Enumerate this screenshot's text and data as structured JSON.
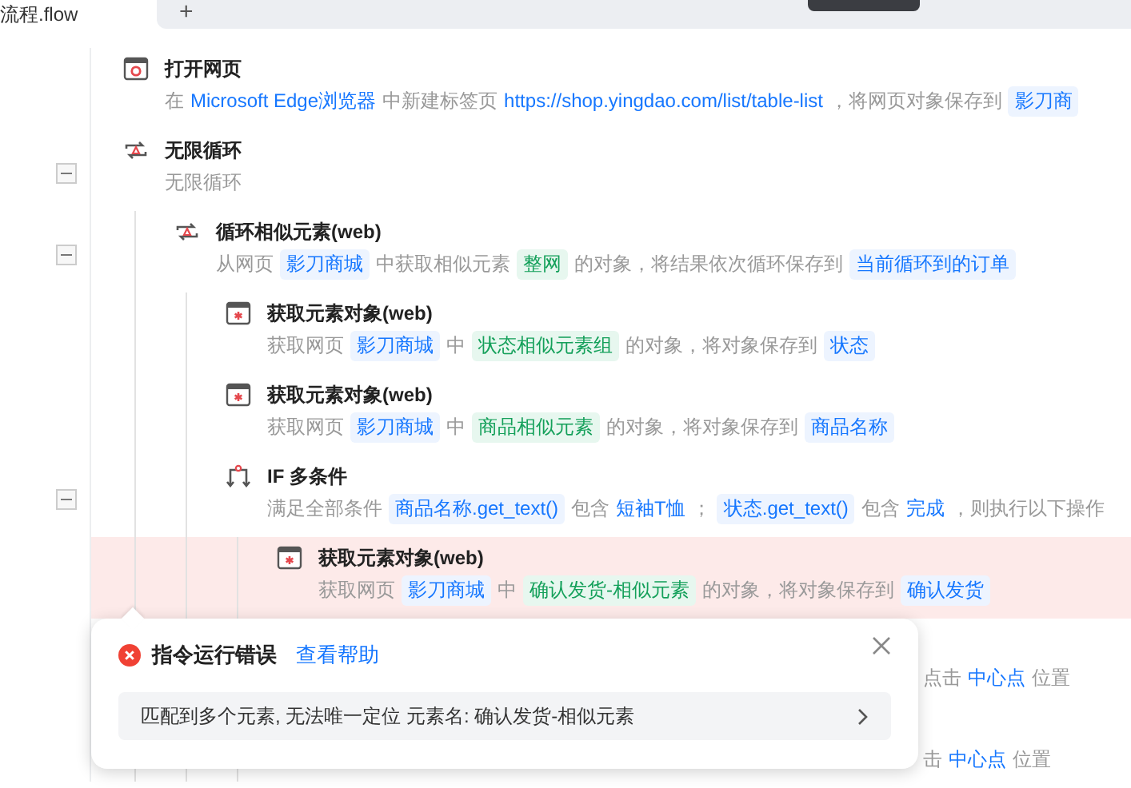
{
  "tab_bar": {
    "tab_label": "流程.flow",
    "add_button": "+"
  },
  "steps": [
    {
      "title": "打开网页",
      "kind": "browser",
      "desc": [
        {
          "t": "在",
          "kind": "text"
        },
        {
          "t": "Microsoft Edge浏览器",
          "kind": "link"
        },
        {
          "t": "中新建标签页",
          "kind": "text"
        },
        {
          "t": "https://shop.yingdao.com/list/table-list",
          "kind": "link"
        },
        {
          "t": "，将网页对象保存到",
          "kind": "text"
        },
        {
          "t": "影刀商",
          "kind": "var"
        }
      ]
    },
    {
      "title": "无限循环",
      "kind": "loop",
      "expanded": true,
      "desc": [
        {
          "t": "无限循环",
          "kind": "text"
        }
      ],
      "children": [
        {
          "title": "循环相似元素(web)",
          "kind": "loop",
          "expanded": true,
          "desc": [
            {
              "t": "从网页",
              "kind": "text"
            },
            {
              "t": "影刀商城",
              "kind": "var"
            },
            {
              "t": "中获取相似元素",
              "kind": "text"
            },
            {
              "t": "整网",
              "kind": "elem"
            },
            {
              "t": "的对象，将结果依次循环保存到",
              "kind": "text"
            },
            {
              "t": "当前循环到的订单",
              "kind": "var"
            }
          ],
          "children": [
            {
              "title": "获取元素对象(web)",
              "kind": "element",
              "desc": [
                {
                  "t": "获取网页",
                  "kind": "text"
                },
                {
                  "t": "影刀商城",
                  "kind": "var"
                },
                {
                  "t": "中",
                  "kind": "text"
                },
                {
                  "t": "状态相似元素组",
                  "kind": "elem"
                },
                {
                  "t": "的对象，将对象保存到",
                  "kind": "text"
                },
                {
                  "t": "状态",
                  "kind": "var"
                }
              ]
            },
            {
              "title": "获取元素对象(web)",
              "kind": "element",
              "desc": [
                {
                  "t": "获取网页",
                  "kind": "text"
                },
                {
                  "t": "影刀商城",
                  "kind": "var"
                },
                {
                  "t": "中",
                  "kind": "text"
                },
                {
                  "t": "商品相似元素",
                  "kind": "elem"
                },
                {
                  "t": "的对象，将对象保存到",
                  "kind": "text"
                },
                {
                  "t": "商品名称",
                  "kind": "var"
                }
              ]
            },
            {
              "title": "IF 多条件",
              "kind": "if",
              "expanded": true,
              "desc": [
                {
                  "t": "满足全部条件",
                  "kind": "text"
                },
                {
                  "t": "商品名称.get_text()",
                  "kind": "var"
                },
                {
                  "t": "包含",
                  "kind": "text"
                },
                {
                  "t": "短袖T恤",
                  "kind": "link"
                },
                {
                  "t": "；",
                  "kind": "text"
                },
                {
                  "t": "状态.get_text()",
                  "kind": "var"
                },
                {
                  "t": "包含",
                  "kind": "text"
                },
                {
                  "t": "完成",
                  "kind": "link"
                },
                {
                  "t": "，则执行以下操作",
                  "kind": "text"
                }
              ],
              "children": [
                {
                  "title": "获取元素对象(web)",
                  "kind": "element",
                  "error": true,
                  "desc": [
                    {
                      "t": "获取网页",
                      "kind": "text"
                    },
                    {
                      "t": "影刀商城",
                      "kind": "var"
                    },
                    {
                      "t": "中",
                      "kind": "text"
                    },
                    {
                      "t": "确认发货-相似元素",
                      "kind": "elem"
                    },
                    {
                      "t": "的对象，将对象保存到",
                      "kind": "text"
                    },
                    {
                      "t": "确认发货",
                      "kind": "var"
                    }
                  ]
                },
                {
                  "kind": "hidden",
                  "desc": [
                    {
                      "t": "点击",
                      "kind": "text"
                    },
                    {
                      "t": "中心点",
                      "kind": "link"
                    },
                    {
                      "t": "位置",
                      "kind": "text"
                    }
                  ]
                },
                {
                  "kind": "hidden",
                  "desc": [
                    {
                      "t": "击",
                      "kind": "text"
                    },
                    {
                      "t": "中心点",
                      "kind": "link"
                    },
                    {
                      "t": "位置",
                      "kind": "text"
                    }
                  ]
                }
              ]
            }
          ]
        }
      ]
    }
  ],
  "error_popup": {
    "title": "指令运行错误",
    "help_link": "查看帮助",
    "message": "匹配到多个元素, 无法唯一定位 元素名: 确认发货-相似元素"
  }
}
